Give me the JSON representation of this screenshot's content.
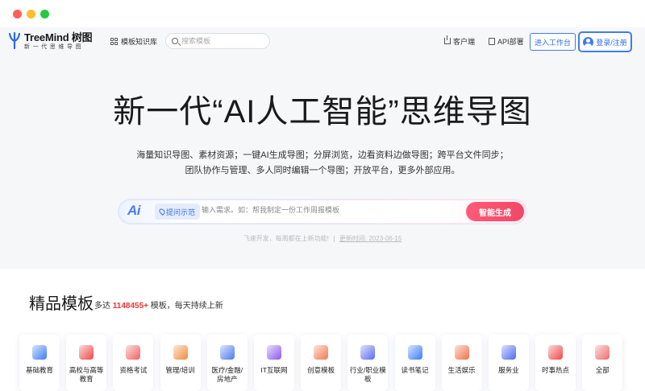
{
  "nav": {
    "brand_name": "TreeMind 树图",
    "brand_sub": "新一代思维导图",
    "template_lib": "模板知识库",
    "search_placeholder": "搜索模板",
    "client": "客户端",
    "api": "API部署",
    "workspace": "进入工作台",
    "login": "登录/注册"
  },
  "hero": {
    "headline": "新一代“AI人工智能”思维导图",
    "desc_line1": "海量知识导图、素材资源；一键AI生成导图；分屏浏览，边看资料边做导图；跨平台文件同步；",
    "desc_line2": "团队协作与管理、多人同时编辑一个导图；开放平台，更多外部应用。",
    "ai_logo": "Ai",
    "example_label": "提问示范",
    "ai_placeholder": "输入需求。如：帮我制定一份工作周报模板",
    "generate": "智能生成",
    "update_note": "飞速开发，每周都在上新功能!",
    "update_date": "更新时间: 2023-06-15"
  },
  "templates": {
    "title": "精品模板",
    "sub_prefix": "多达",
    "count": "1148455+",
    "sub_suffix": "模板，每天持续上新",
    "categories": [
      {
        "label": "基础教育",
        "icon": "book-icon",
        "color": "#3d7cf5"
      },
      {
        "label": "高校与高等教育",
        "icon": "graduation-cap-icon",
        "color": "#f04848"
      },
      {
        "label": "资格考试",
        "icon": "certificate-icon",
        "color": "#f06060"
      },
      {
        "label": "管理/培训",
        "icon": "presentation-icon",
        "color": "#f08a3c"
      },
      {
        "label": "医疗/金融/房地产",
        "icon": "building-icon",
        "color": "#4d7af0"
      },
      {
        "label": "IT互联网",
        "icon": "planet-icon",
        "color": "#8a5af0"
      },
      {
        "label": "创意模板",
        "icon": "lightbulb-icon",
        "color": "#f07a50"
      },
      {
        "label": "行业/职业模板",
        "icon": "briefcase-icon",
        "color": "#5a6ef0"
      },
      {
        "label": "读书笔记",
        "icon": "notebook-icon",
        "color": "#3d7cf5"
      },
      {
        "label": "生活娱乐",
        "icon": "gamepad-icon",
        "color": "#f07048"
      },
      {
        "label": "服务业",
        "icon": "badge-icon",
        "color": "#4d6af0"
      },
      {
        "label": "时事热点",
        "icon": "flame-icon",
        "color": "#f04848"
      },
      {
        "label": "全部",
        "icon": "apps-icon",
        "color": "#f06a6a"
      }
    ]
  }
}
